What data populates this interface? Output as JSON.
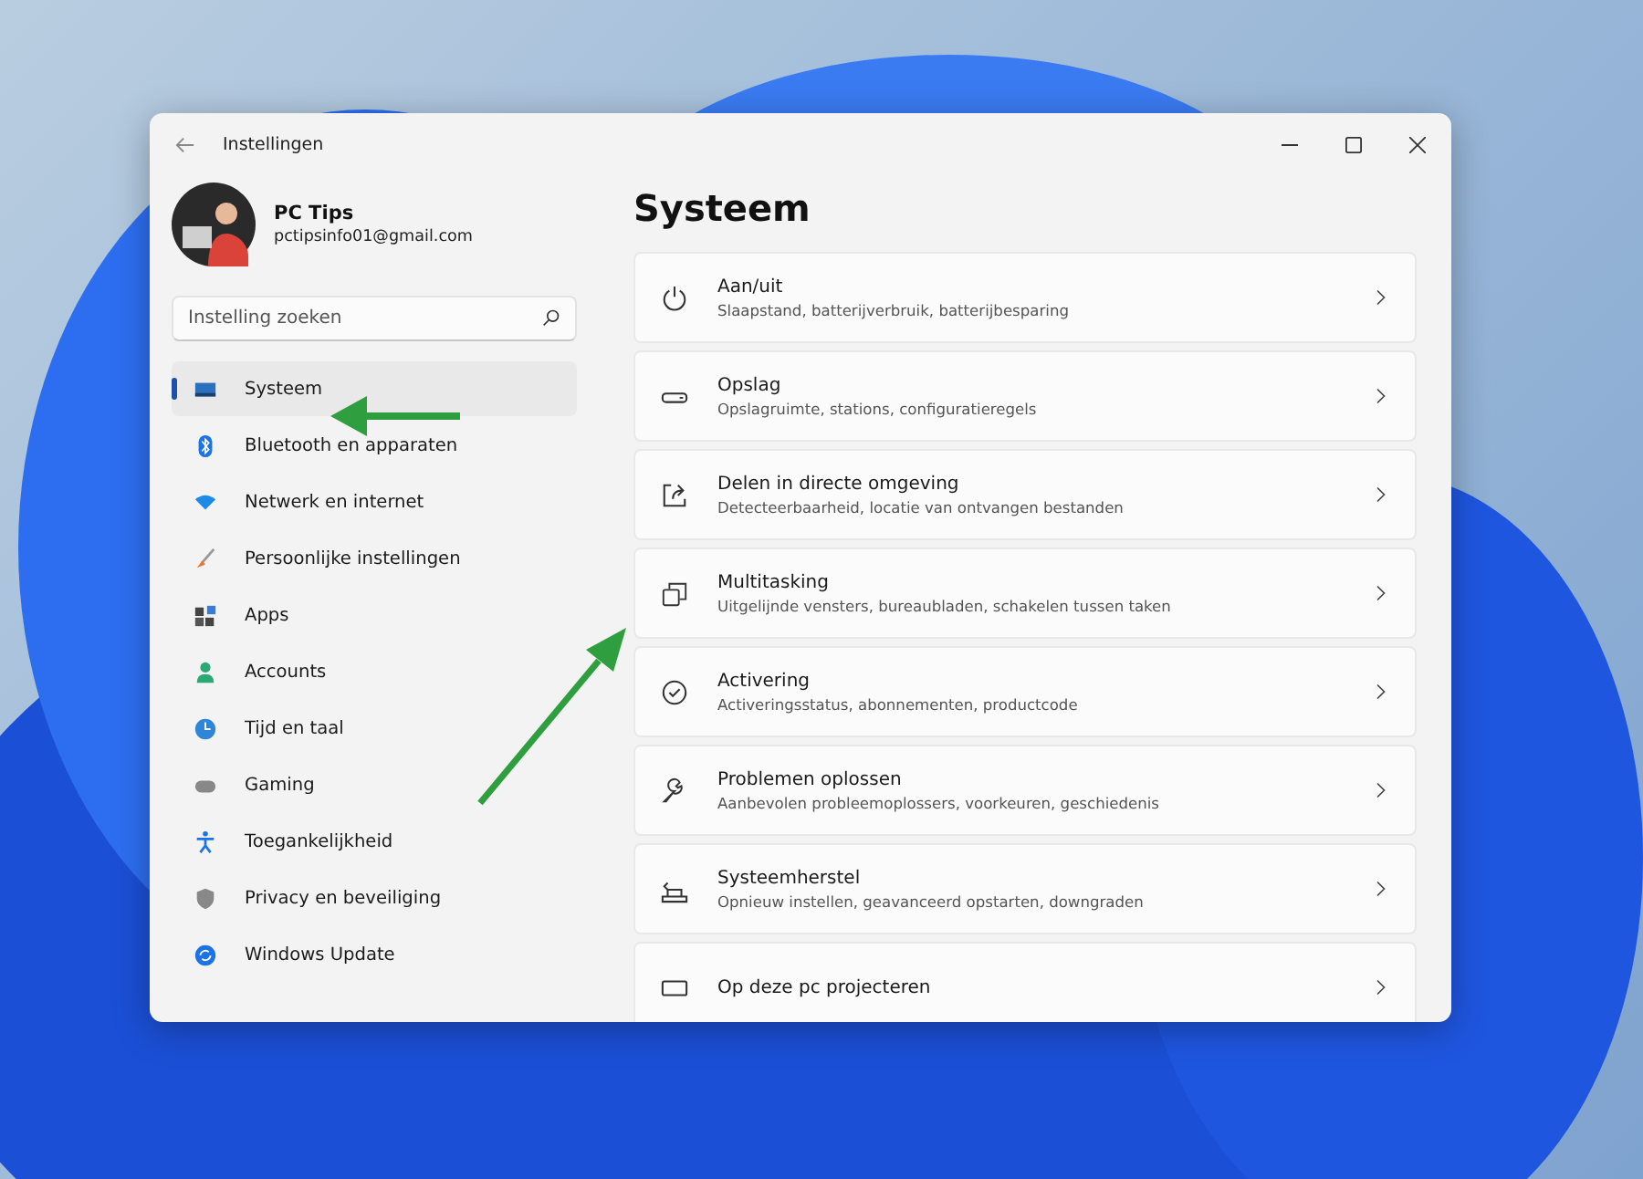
{
  "window": {
    "title": "Instellingen"
  },
  "account": {
    "name": "PC Tips",
    "email": "pctipsinfo01@gmail.com"
  },
  "search": {
    "placeholder": "Instelling zoeken"
  },
  "sidebar": {
    "items": [
      {
        "label": "Systeem",
        "selected": true
      },
      {
        "label": "Bluetooth en apparaten",
        "selected": false
      },
      {
        "label": "Netwerk en internet",
        "selected": false
      },
      {
        "label": "Persoonlijke instellingen",
        "selected": false
      },
      {
        "label": "Apps",
        "selected": false
      },
      {
        "label": "Accounts",
        "selected": false
      },
      {
        "label": "Tijd en taal",
        "selected": false
      },
      {
        "label": "Gaming",
        "selected": false
      },
      {
        "label": "Toegankelijkheid",
        "selected": false
      },
      {
        "label": "Privacy en beveiliging",
        "selected": false
      },
      {
        "label": "Windows Update",
        "selected": false
      }
    ]
  },
  "page": {
    "title": "Systeem"
  },
  "settings": [
    {
      "title": "Aan/uit",
      "description": "Slaapstand, batterijverbruik, batterijbesparing"
    },
    {
      "title": "Opslag",
      "description": "Opslagruimte, stations, configuratieregels"
    },
    {
      "title": "Delen in directe omgeving",
      "description": "Detecteerbaarheid, locatie van ontvangen bestanden"
    },
    {
      "title": "Multitasking",
      "description": "Uitgelijnde vensters, bureaubladen, schakelen tussen taken"
    },
    {
      "title": "Activering",
      "description": "Activeringsstatus, abonnementen, productcode"
    },
    {
      "title": "Problemen oplossen",
      "description": "Aanbevolen probleemoplossers, voorkeuren, geschiedenis"
    },
    {
      "title": "Systeemherstel",
      "description": "Opnieuw instellen, geavanceerd opstarten, downgraden"
    },
    {
      "title": "Op deze pc projecteren"
    }
  ]
}
